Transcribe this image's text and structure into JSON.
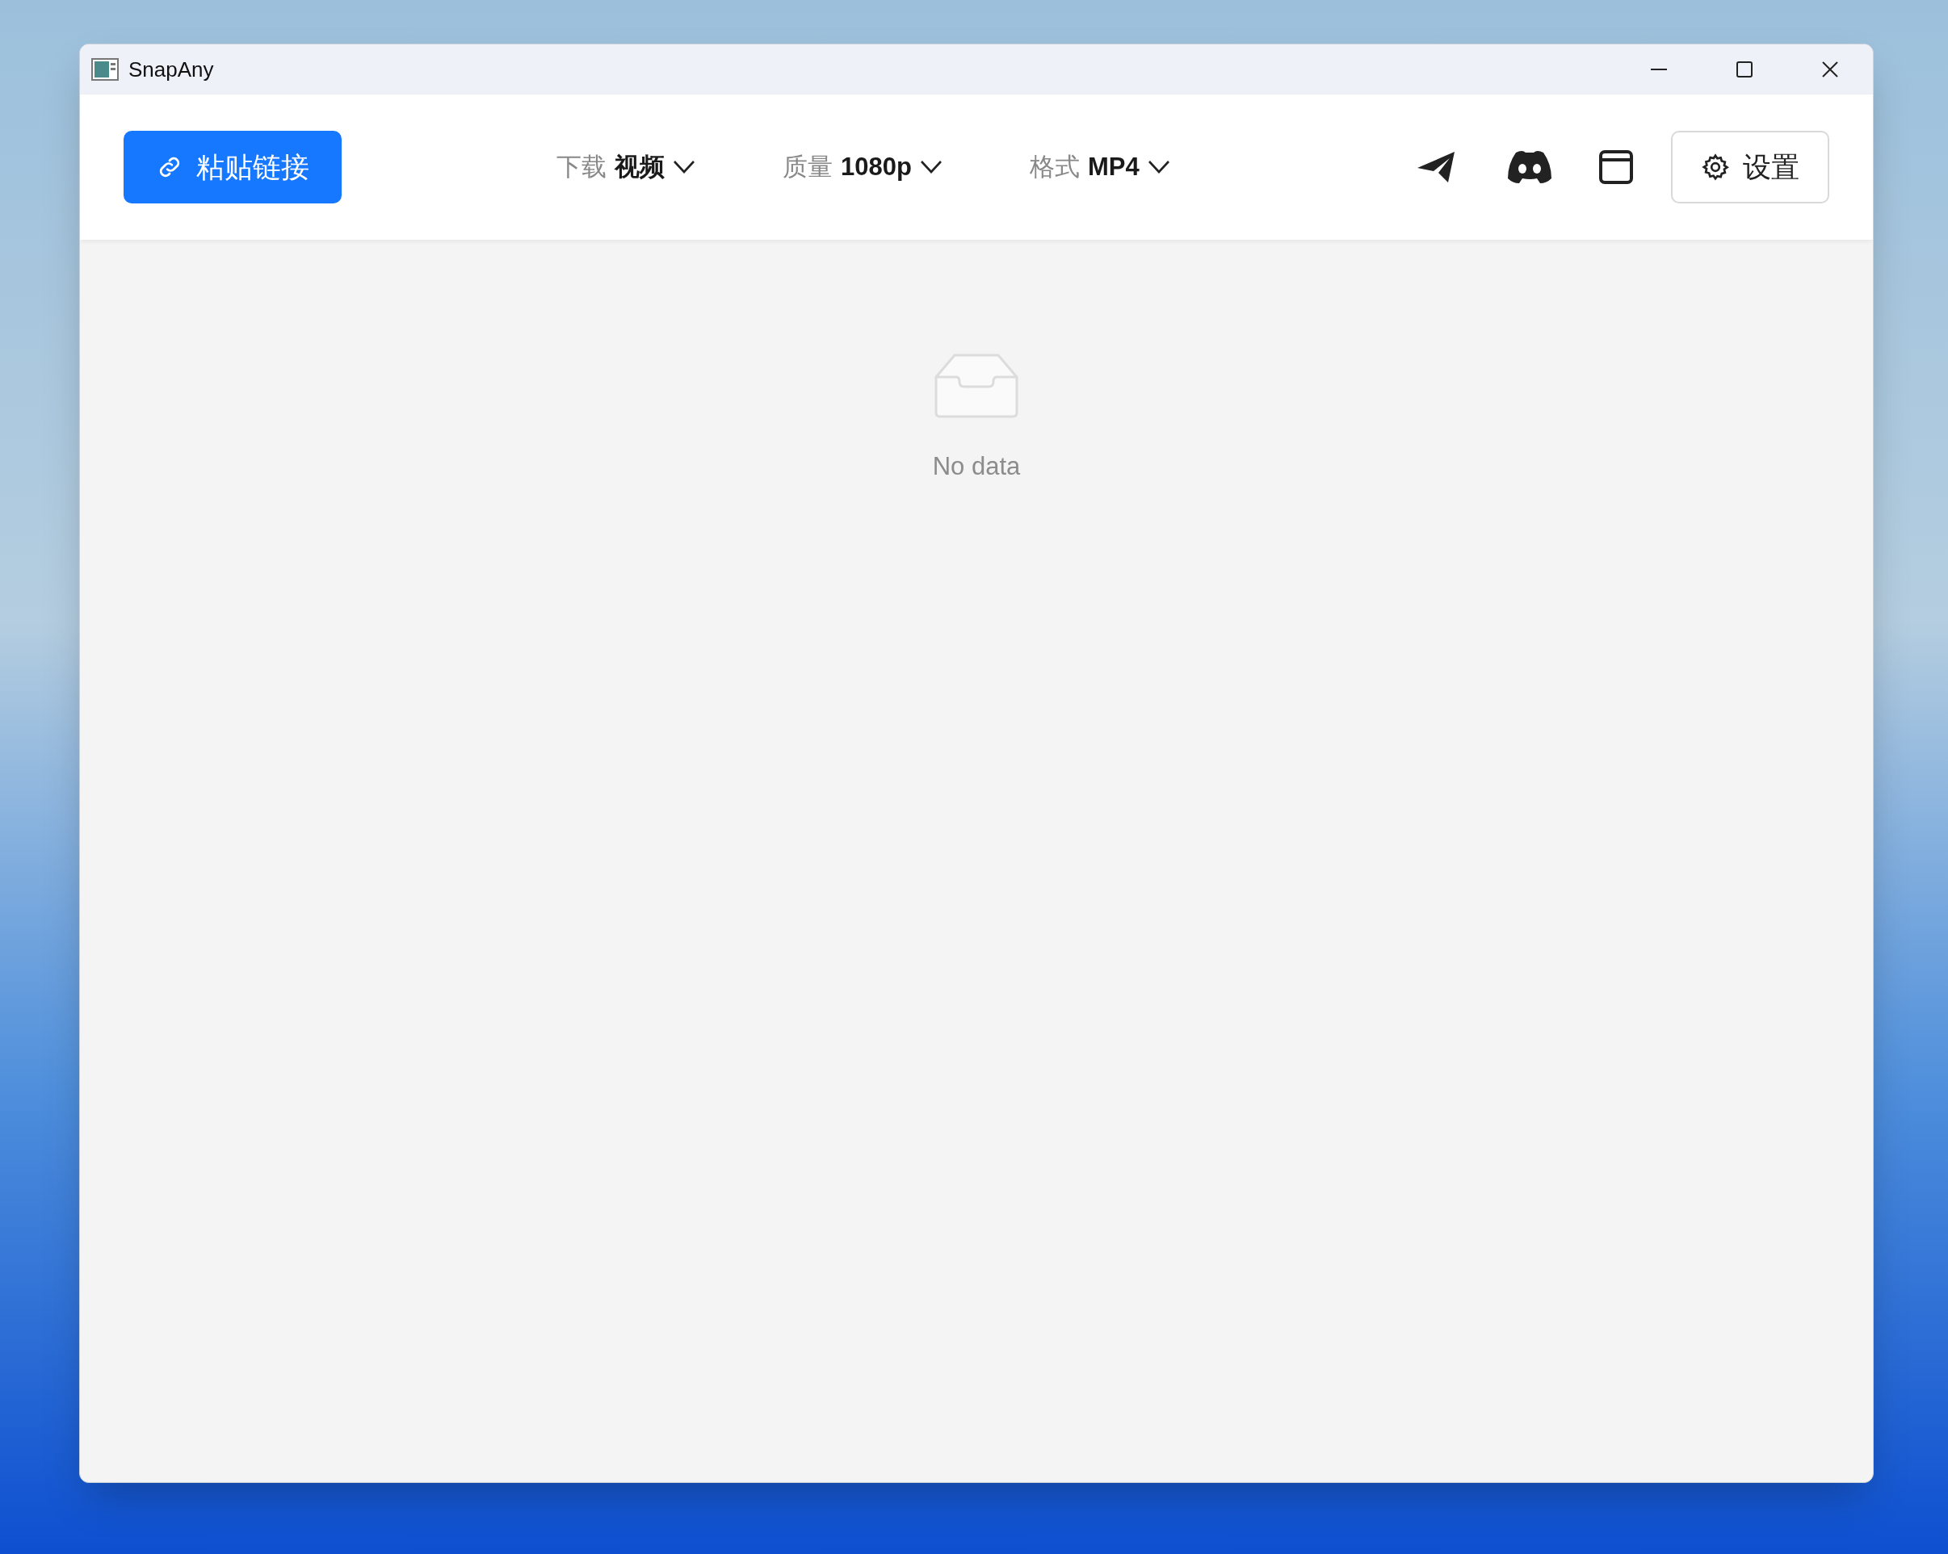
{
  "window": {
    "title": "SnapAny"
  },
  "toolbar": {
    "paste_button": "粘贴链接",
    "dropdowns": [
      {
        "label": "下载",
        "value": "视频"
      },
      {
        "label": "质量",
        "value": "1080p"
      },
      {
        "label": "格式",
        "value": "MP4"
      }
    ],
    "settings_button": "设置"
  },
  "empty_state": {
    "text": "No data"
  }
}
